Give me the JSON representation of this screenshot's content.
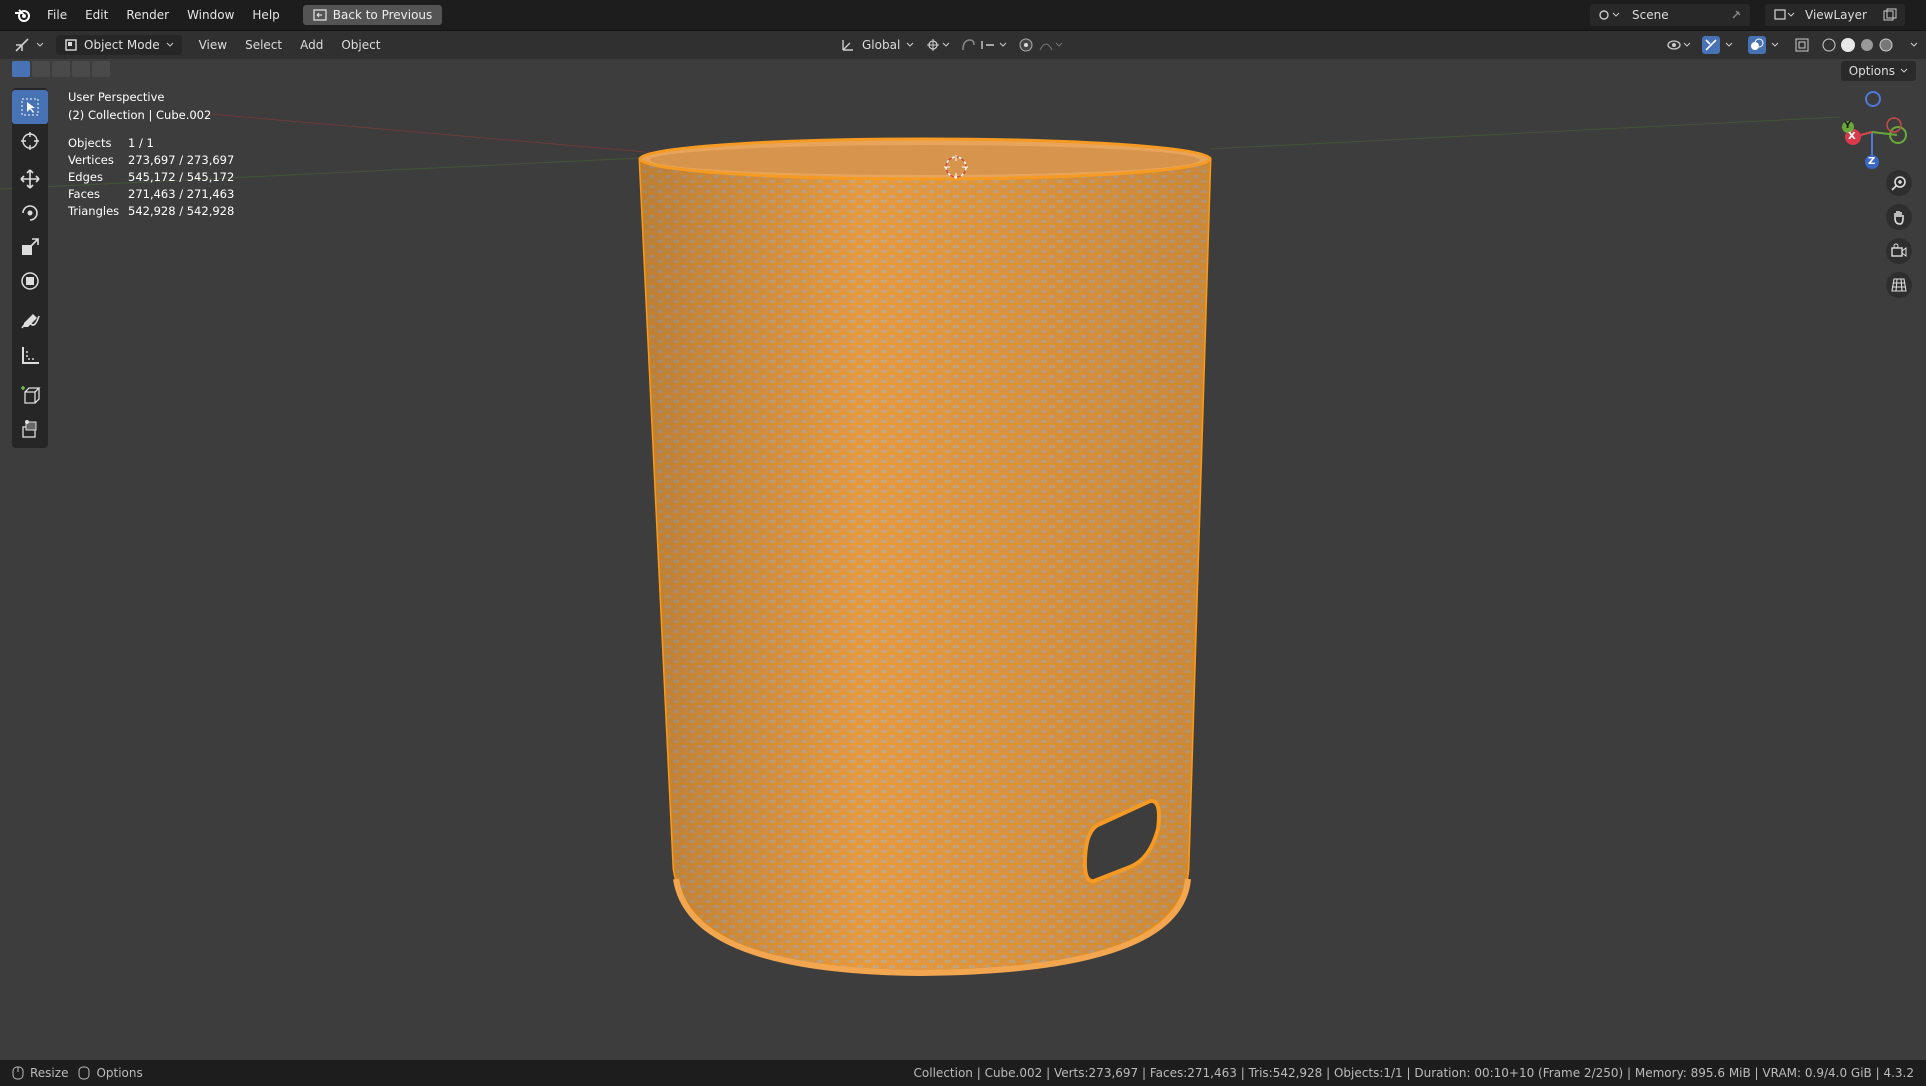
{
  "menu": {
    "file": "File",
    "edit": "Edit",
    "render": "Render",
    "window": "Window",
    "help": "Help",
    "back_to_previous": "Back to Previous"
  },
  "scene": {
    "scene_name": "Scene",
    "view_layer": "ViewLayer"
  },
  "header": {
    "mode": "Object Mode",
    "view": "View",
    "select": "Select",
    "add": "Add",
    "object": "Object",
    "transform_orientation": "Global",
    "options": "Options"
  },
  "viewport": {
    "perspective_label": "User Perspective",
    "collection_label": "(2) Collection | Cube.002",
    "stats": [
      {
        "key": "Objects",
        "value": "1 / 1"
      },
      {
        "key": "Vertices",
        "value": "273,697 / 273,697"
      },
      {
        "key": "Edges",
        "value": "545,172 / 545,172"
      },
      {
        "key": "Faces",
        "value": "271,463 / 271,463"
      },
      {
        "key": "Triangles",
        "value": "542,928 / 542,928"
      }
    ],
    "gizmo": {
      "x": "X",
      "y": "Y",
      "z": "Z"
    }
  },
  "colors": {
    "selection_orange": "#f59a23",
    "active_tool": "#4772b3",
    "background": "#3d3d3d"
  },
  "statusbar": {
    "resize": "Resize",
    "options": "Options",
    "info": "Collection | Cube.002 | Verts:273,697 | Faces:271,463 | Tris:542,928 | Objects:1/1 | Duration: 00:10+10 (Frame 2/250) | Memory: 895.6 MiB | VRAM: 0.9/4.0 GiB | 4.3.2"
  }
}
